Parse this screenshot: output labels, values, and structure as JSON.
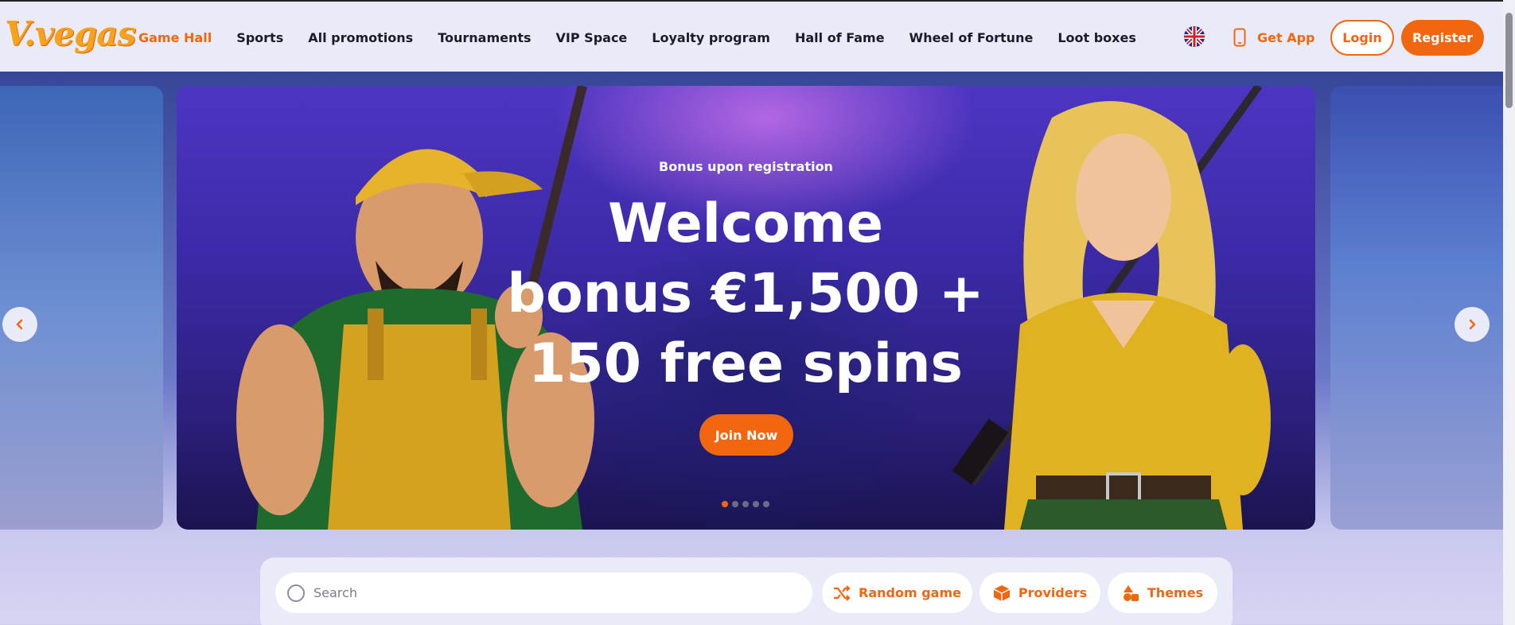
{
  "header": {
    "logo_text": "V.vegas",
    "nav": [
      {
        "label": "Game Hall",
        "active": true
      },
      {
        "label": "Sports",
        "active": false
      },
      {
        "label": "All promotions",
        "active": false
      },
      {
        "label": "Tournaments",
        "active": false
      },
      {
        "label": "VIP Space",
        "active": false
      },
      {
        "label": "Loyalty program",
        "active": false
      },
      {
        "label": "Hall of Fame",
        "active": false
      },
      {
        "label": "Wheel of Fortune",
        "active": false
      },
      {
        "label": "Loot boxes",
        "active": false
      }
    ],
    "language_icon": "uk-flag-icon",
    "get_app_label": "Get App",
    "login_label": "Login",
    "register_label": "Register"
  },
  "hero": {
    "subtitle": "Bonus upon registration",
    "title": "Welcome bonus €1,500 + 150 free spins",
    "cta_label": "Join Now",
    "slide_count": 5,
    "active_slide": 0
  },
  "search": {
    "placeholder": "Search",
    "random_label": "Random game",
    "providers_label": "Providers",
    "themes_label": "Themes"
  },
  "colors": {
    "accent": "#f2660f",
    "header_bg": "#e9ecf8"
  }
}
